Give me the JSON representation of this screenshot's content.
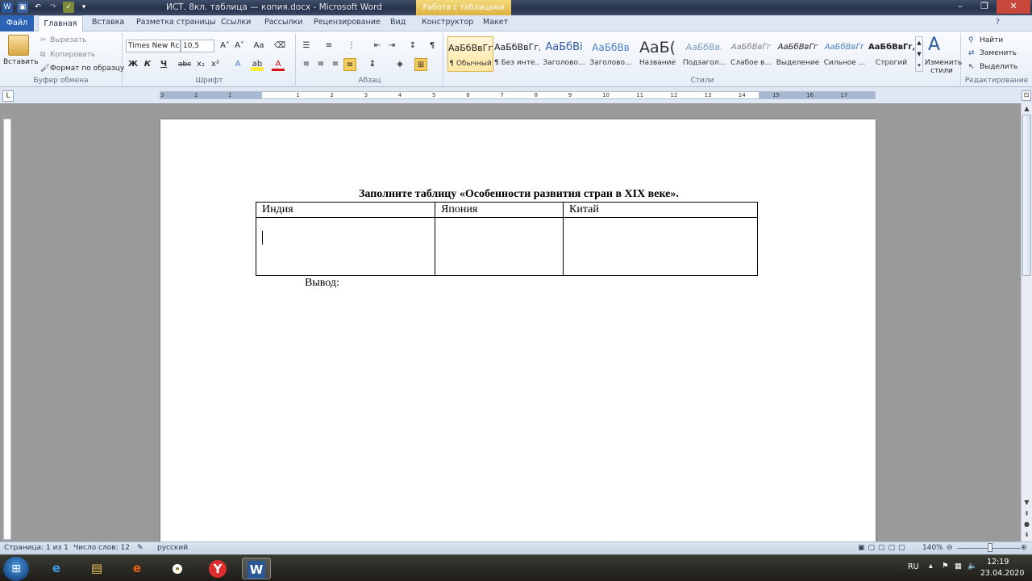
{
  "window": {
    "title": "ИСТ. 8кл. таблица — копия.docx - Microsoft Word",
    "contextual_tab": "Работа с таблицами",
    "app_icon": "W"
  },
  "tabs": {
    "file": "Файл",
    "items": [
      "Главная",
      "Вставка",
      "Разметка страницы",
      "Ссылки",
      "Рассылки",
      "Рецензирование",
      "Вид",
      "Конструктор",
      "Макет"
    ]
  },
  "ribbon": {
    "clipboard": {
      "paste": "Вставить",
      "cut": "Вырезать",
      "copy": "Копировать",
      "format_painter": "Формат по образцу",
      "label": "Буфер обмена"
    },
    "font": {
      "name": "Times New Rc",
      "size": "10,5",
      "bold": "Ж",
      "italic": "К",
      "underline": "Ч",
      "strike": "abc",
      "subscript": "x₂",
      "superscript": "x²",
      "grow": "A˄",
      "shrink": "A˅",
      "case": "Aa",
      "label": "Шрифт"
    },
    "paragraph": {
      "label": "Абзац",
      "pilcrow": "¶"
    },
    "styles": {
      "label": "Стили",
      "items": [
        {
          "preview": "АаБбВвГг,",
          "name": "¶ Обычный"
        },
        {
          "preview": "АаБбВвГг,",
          "name": "¶ Без инте..."
        },
        {
          "preview": "АаБбВі",
          "name": "Заголово..."
        },
        {
          "preview": "АаБбВв",
          "name": "Заголово..."
        },
        {
          "preview": "АаБ(",
          "name": "Название"
        },
        {
          "preview": "АаБбВв.",
          "name": "Подзагол..."
        },
        {
          "preview": "АаБбВвГг",
          "name": "Слабое в..."
        },
        {
          "preview": "АаБбВвГг",
          "name": "Выделение"
        },
        {
          "preview": "АаБбВвГг",
          "name": "Сильное ..."
        },
        {
          "preview": "АаБбВвГг,",
          "name": "Строгий"
        }
      ],
      "change": "Изменить стили"
    },
    "editing": {
      "find": "Найти",
      "replace": "Заменить",
      "select": "Выделить",
      "label": "Редактирование"
    }
  },
  "ruler": {
    "ticks": [
      "3",
      "2",
      "1",
      "1",
      "2",
      "3",
      "4",
      "5",
      "6",
      "7",
      "8",
      "9",
      "10",
      "11",
      "12",
      "13",
      "14",
      "15",
      "16",
      "17"
    ]
  },
  "document": {
    "title": "Заполните таблицу «Особенности развития стран в XIX веке».",
    "table_headers": [
      "Индия",
      "Япония",
      "Китай"
    ],
    "table_row": [
      "",
      "",
      ""
    ],
    "conclusion": "Вывод:"
  },
  "statusbar": {
    "page": "Страница: 1 из 1",
    "words": "Число слов: 12",
    "language": "русский",
    "zoom": "140%"
  },
  "taskbar": {
    "lang": "RU",
    "time": "12:19",
    "date": "23.04.2020"
  },
  "colors": {
    "file_tab": "#2d63b5",
    "contextual": "#dcb242",
    "titlebar": "#26324a"
  }
}
